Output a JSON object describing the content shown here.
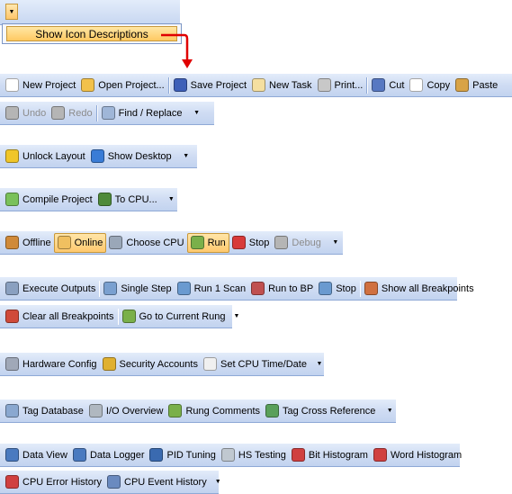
{
  "top_menu": {
    "show_icon_descriptions": "Show Icon Descriptions"
  },
  "toolbars": [
    {
      "items": [
        {
          "label": "New Project",
          "icon": "new-document-icon",
          "color": "#ffffff"
        },
        {
          "label": "Open Project...",
          "icon": "open-folder-icon",
          "color": "#f2c14b"
        },
        {
          "sep": true
        },
        {
          "label": "Save Project",
          "icon": "save-icon",
          "color": "#3d5fb8"
        },
        {
          "label": "New Task",
          "icon": "new-task-icon",
          "color": "#f5dfa0"
        },
        {
          "label": "Print...",
          "icon": "print-icon",
          "color": "#c8c8c8"
        },
        {
          "sep": true
        },
        {
          "label": "Cut",
          "icon": "cut-icon",
          "color": "#5778c2"
        },
        {
          "label": "Copy",
          "icon": "copy-icon",
          "color": "#ffffff"
        },
        {
          "label": "Paste",
          "icon": "paste-icon",
          "color": "#d8a347"
        }
      ]
    },
    {
      "dropdown": true,
      "items": [
        {
          "label": "Undo",
          "icon": "undo-icon",
          "color": "#b5b5b5",
          "disabled": true
        },
        {
          "label": "Redo",
          "icon": "redo-icon",
          "color": "#b5b5b5",
          "disabled": true
        },
        {
          "sep": true
        },
        {
          "label": "Find / Replace",
          "icon": "find-replace-icon",
          "color": "#9fb6d8"
        }
      ]
    },
    {
      "dropdown": true,
      "items": [
        {
          "label": "Unlock Layout",
          "icon": "lock-icon",
          "color": "#f0c629"
        },
        {
          "label": "Show Desktop",
          "icon": "show-desktop-icon",
          "color": "#3a7cd6"
        }
      ]
    },
    {
      "dropdown": true,
      "items": [
        {
          "label": "Compile Project",
          "icon": "compile-icon",
          "color": "#7ac15a"
        },
        {
          "label": "To CPU...",
          "icon": "to-cpu-icon",
          "color": "#4f8a3a"
        }
      ]
    },
    {
      "dropdown": true,
      "items": [
        {
          "label": "Offline",
          "icon": "offline-icon",
          "color": "#d08a3a"
        },
        {
          "label": "Online",
          "icon": "online-icon",
          "color": "#f0c060",
          "active": true
        },
        {
          "label": "Choose CPU",
          "icon": "choose-cpu-icon",
          "color": "#9aa7b8"
        },
        {
          "label": "Run",
          "icon": "run-icon",
          "color": "#7ab04a",
          "active": true
        },
        {
          "label": "Stop",
          "icon": "stop-icon",
          "color": "#d83a3a"
        },
        {
          "label": "Debug",
          "icon": "debug-icon",
          "color": "#b5b5b5",
          "disabled": true
        }
      ]
    },
    {
      "items": [
        {
          "label": "Execute Outputs",
          "icon": "execute-outputs-icon",
          "color": "#8aa0c0"
        },
        {
          "sep": true
        },
        {
          "label": "Single Step",
          "icon": "single-step-icon",
          "color": "#7aa0d0"
        },
        {
          "label": "Run 1 Scan",
          "icon": "run-scan-icon",
          "color": "#6a9ad0"
        },
        {
          "label": "Run to BP",
          "icon": "run-to-bp-icon",
          "color": "#c05050"
        },
        {
          "label": "Stop",
          "icon": "stop-debug-icon",
          "color": "#6a9ad0"
        },
        {
          "sep": true
        },
        {
          "label": "Show all Breakpoints",
          "icon": "breakpoints-icon",
          "color": "#d07040"
        }
      ]
    },
    {
      "dropdown": true,
      "items": [
        {
          "label": "Clear all Breakpoints",
          "icon": "clear-breakpoints-icon",
          "color": "#d04a3a"
        },
        {
          "sep": true
        },
        {
          "label": "Go to Current Rung",
          "icon": "go-to-rung-icon",
          "color": "#7ab04a"
        }
      ]
    },
    {
      "dropdown": true,
      "items": [
        {
          "label": "Hardware Config",
          "icon": "hardware-config-icon",
          "color": "#a0a8b8"
        },
        {
          "label": "Security Accounts",
          "icon": "security-keys-icon",
          "color": "#e0b030"
        },
        {
          "label": "Set CPU Time/Date",
          "icon": "clock-icon",
          "color": "#f0f0f0"
        }
      ]
    },
    {
      "dropdown": true,
      "items": [
        {
          "label": "Tag Database",
          "icon": "database-icon",
          "color": "#8aa8d0"
        },
        {
          "label": "I/O Overview",
          "icon": "io-overview-icon",
          "color": "#b0b8c0"
        },
        {
          "label": "Rung Comments",
          "icon": "rung-comments-icon",
          "color": "#7ab04a"
        },
        {
          "label": "Tag Cross Reference",
          "icon": "cross-reference-icon",
          "color": "#5aa05a"
        }
      ]
    },
    {
      "items": [
        {
          "label": "Data View",
          "icon": "data-view-icon",
          "color": "#4a7ac0"
        },
        {
          "label": "Data Logger",
          "icon": "data-logger-icon",
          "color": "#4a7ac0"
        },
        {
          "label": "PID Tuning",
          "icon": "pid-tuning-icon",
          "color": "#3a6ab0"
        },
        {
          "label": "HS Testing",
          "icon": "hs-testing-icon",
          "color": "#c0c8d0"
        },
        {
          "label": "Bit Histogram",
          "icon": "bit-histogram-icon",
          "color": "#d04040"
        },
        {
          "label": "Word Histogram",
          "icon": "word-histogram-icon",
          "color": "#d04040"
        }
      ]
    },
    {
      "dropdown": true,
      "items": [
        {
          "label": "CPU Error History",
          "icon": "cpu-error-icon",
          "color": "#d04040"
        },
        {
          "label": "CPU Event History",
          "icon": "cpu-event-icon",
          "color": "#6a8ac0"
        }
      ]
    }
  ]
}
